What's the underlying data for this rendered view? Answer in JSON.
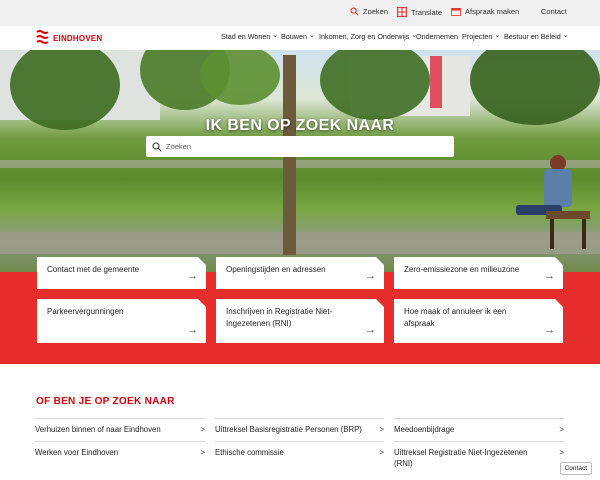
{
  "utility": {
    "search_label": "Zoeken",
    "translate_label": "Translate",
    "appointment_label": "Afspraak maken",
    "contact_label": "Contact"
  },
  "header": {
    "logo_text": "EINDHOVEN",
    "nav": [
      {
        "label": "Stad en Wonen"
      },
      {
        "label": "Bouwen"
      },
      {
        "label": "Inkomen, Zorg en Onderwijs"
      },
      {
        "label": "Ondernemen"
      },
      {
        "label": "Projecten"
      },
      {
        "label": "Bestuur en Beleid"
      }
    ]
  },
  "hero": {
    "title": "IK BEN OP ZOEK NAAR",
    "search_placeholder": "Zoeken"
  },
  "cards": [
    {
      "label": "Contact met de gemeente"
    },
    {
      "label": "Openingstijden en adressen"
    },
    {
      "label": "Zero-emissiezone en milieuzone"
    },
    {
      "label": "Parkeervergunningen"
    },
    {
      "label": "Inschrijven in Registratie Niet-Ingezetenen (RNI)"
    },
    {
      "label": "Hoe maak of annuleer ik een afspraak"
    }
  ],
  "section": {
    "title": "OF BEN JE OP ZOEK NAAR",
    "links": [
      {
        "label": "Verhuizen binnen of naar Eindhoven"
      },
      {
        "label": "Uittreksel Basisregistratie Personen (BRP)"
      },
      {
        "label": "Meedoenbijdrage"
      },
      {
        "label": "Werken voor Eindhoven"
      },
      {
        "label": "Ethische commissie"
      },
      {
        "label": "Uittreksel Registratie Niet-Ingezetenen (RNI)"
      }
    ]
  },
  "floating": {
    "contact_label": "Contact"
  },
  "colors": {
    "brand_red": "#e52e2c",
    "logo_red": "#d6000d",
    "utility_bg": "#f0f0f0"
  },
  "icons": [
    "search-icon",
    "translate-icon",
    "calendar-icon",
    "eindhoven-logo",
    "arrow-right-icon",
    "chevron-down-icon"
  ]
}
